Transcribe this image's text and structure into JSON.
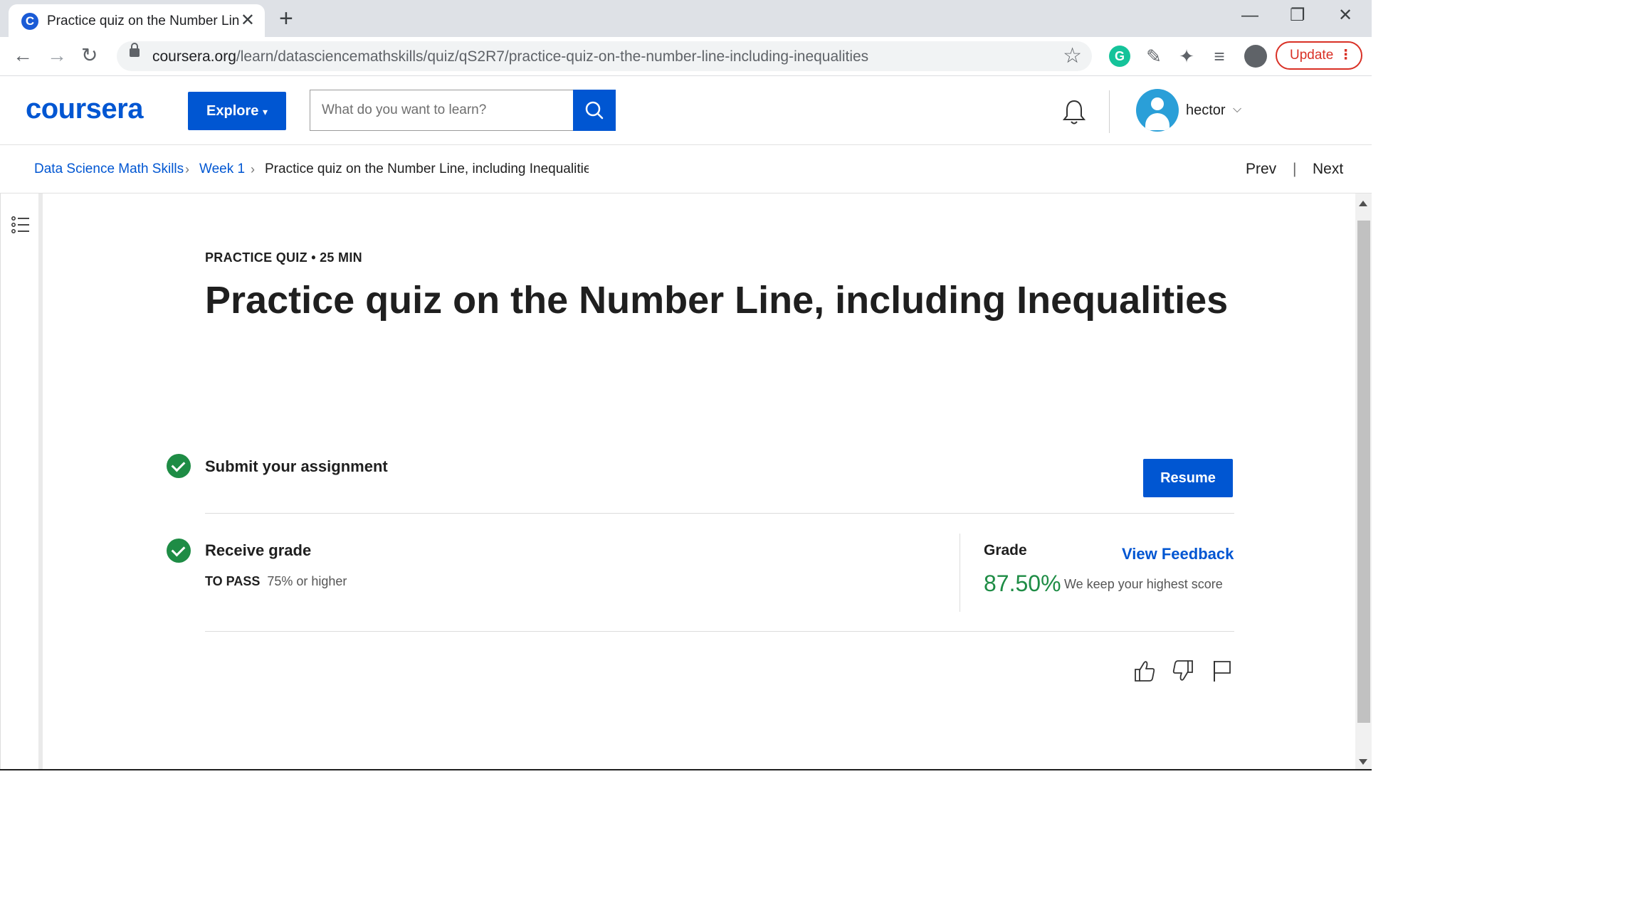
{
  "browser": {
    "tab_title": "Practice quiz on the Number Line, including Inequalities",
    "url_host": "coursera.org",
    "url_path": "/learn/datasciencemathskills/quiz/qS2R7/practice-quiz-on-the-number-line-including-inequalities",
    "update_label": "Update"
  },
  "header": {
    "logo": "coursera",
    "explore_label": "Explore",
    "search_placeholder": "What do you want to learn?",
    "username": "hector"
  },
  "breadcrumb": {
    "items": [
      "Data Science Math Skills",
      "Week 1"
    ],
    "current": "Practice quiz on the Number Line, including Inequalities",
    "prev_label": "Prev",
    "next_label": "Next"
  },
  "quiz": {
    "meta": "PRACTICE QUIZ • 25 MIN",
    "title": "Practice quiz on the Number Line, including Inequalities",
    "steps": {
      "submit": {
        "title": "Submit your assignment",
        "button": "Resume"
      },
      "grade": {
        "title": "Receive grade",
        "to_pass_label": "TO PASS",
        "to_pass_value": "75% or higher",
        "grade_label": "Grade",
        "view_feedback": "View Feedback",
        "grade_value": "87.50%",
        "grade_note": "We keep your highest score"
      }
    }
  },
  "colors": {
    "brand": "#0056d2",
    "success": "#1e8c45",
    "update_red": "#d93025"
  }
}
